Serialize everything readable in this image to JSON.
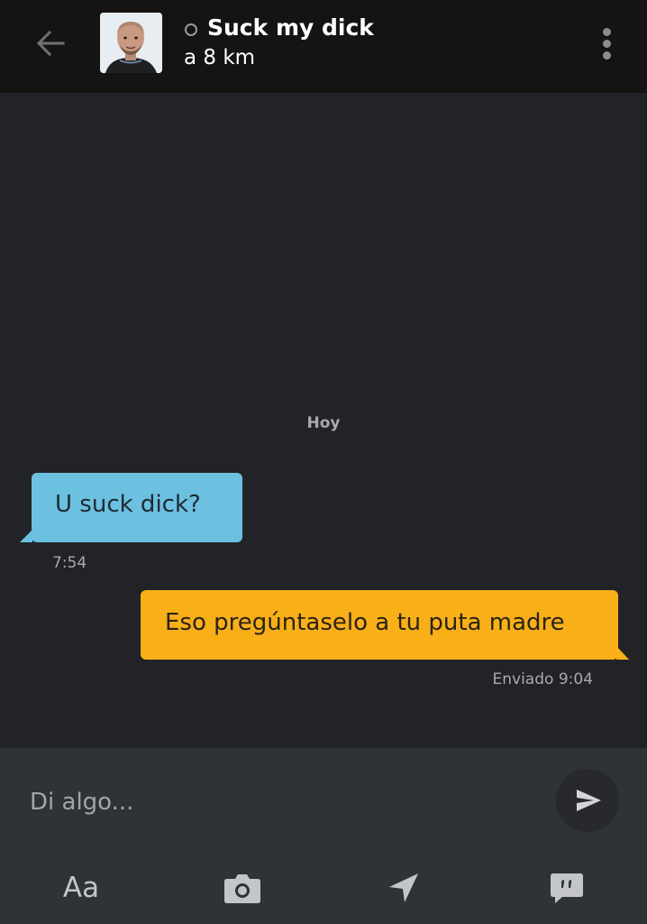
{
  "header": {
    "contact_name": "Suck my dick",
    "distance": "a 8 km",
    "status": "offline",
    "back_icon": "arrow-left-icon",
    "menu_icon": "more-vertical-icon"
  },
  "chat": {
    "date_separator": "Hoy",
    "messages": [
      {
        "direction": "received",
        "text": "U suck dick?",
        "time": "7:54",
        "color": "#6cc0e0"
      },
      {
        "direction": "sent",
        "text": "Eso pregúntaselo a tu puta madre",
        "time": "Enviado 9:04",
        "color": "#f8af18"
      }
    ]
  },
  "composer": {
    "placeholder": "Di algo...",
    "value": "",
    "send_icon": "send-icon"
  },
  "toolbar": {
    "format_label": "Aa",
    "camera_icon": "camera-icon",
    "location_icon": "location-arrow-icon",
    "phrases_icon": "saved-phrases-icon"
  },
  "colors": {
    "header_bg": "#161412",
    "chat_bg": "#222326",
    "composer_bg": "#2f3236",
    "received_bubble": "#6cc0e0",
    "sent_bubble": "#f8af18"
  }
}
